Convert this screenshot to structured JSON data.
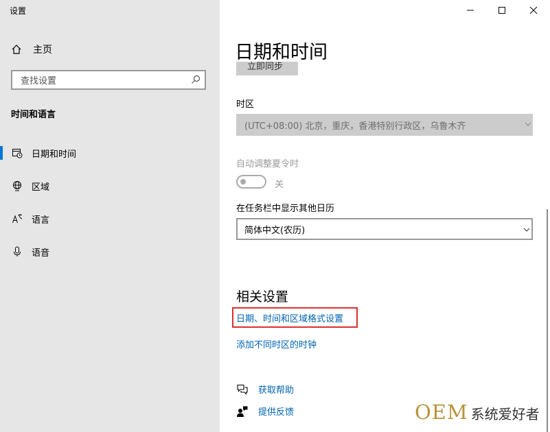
{
  "app": {
    "title": "设置"
  },
  "sidebar": {
    "home_label": "主页",
    "search_placeholder": "查找设置",
    "section_header": "时间和语言",
    "items": [
      {
        "label": "日期和时间",
        "icon": "calendar-clock-icon",
        "selected": true
      },
      {
        "label": "区域",
        "icon": "globe-icon",
        "selected": false
      },
      {
        "label": "语言",
        "icon": "language-icon",
        "selected": false
      },
      {
        "label": "语音",
        "icon": "microphone-icon",
        "selected": false
      }
    ]
  },
  "window_controls": {
    "minimize": "minimize-icon",
    "maximize": "maximize-icon",
    "close": "close-icon"
  },
  "main": {
    "title": "日期和时间",
    "sync_button_label": "立即同步",
    "timezone": {
      "label": "时区",
      "value": "(UTC+08:00) 北京，重庆，香港特别行政区，乌鲁木齐",
      "disabled": true
    },
    "dst": {
      "label": "自动调整夏令时",
      "state_label": "关",
      "on": false,
      "disabled": true
    },
    "calendar": {
      "label": "在任务栏中显示其他日历",
      "value": "简体中文(农历)"
    },
    "related": {
      "title": "相关设置",
      "links": [
        "日期、时间和区域格式设置",
        "添加不同时区的时钟"
      ]
    },
    "help": [
      {
        "label": "获取帮助",
        "icon": "help-chat-icon"
      },
      {
        "label": "提供反馈",
        "icon": "feedback-icon"
      }
    ]
  },
  "colors": {
    "accent": "#0078d7",
    "link": "#0063b1",
    "highlight": "#d9302c",
    "sidebar_bg": "#e6e6e6"
  },
  "watermark": {
    "brand": "OEM",
    "text": "系统爱好者"
  }
}
